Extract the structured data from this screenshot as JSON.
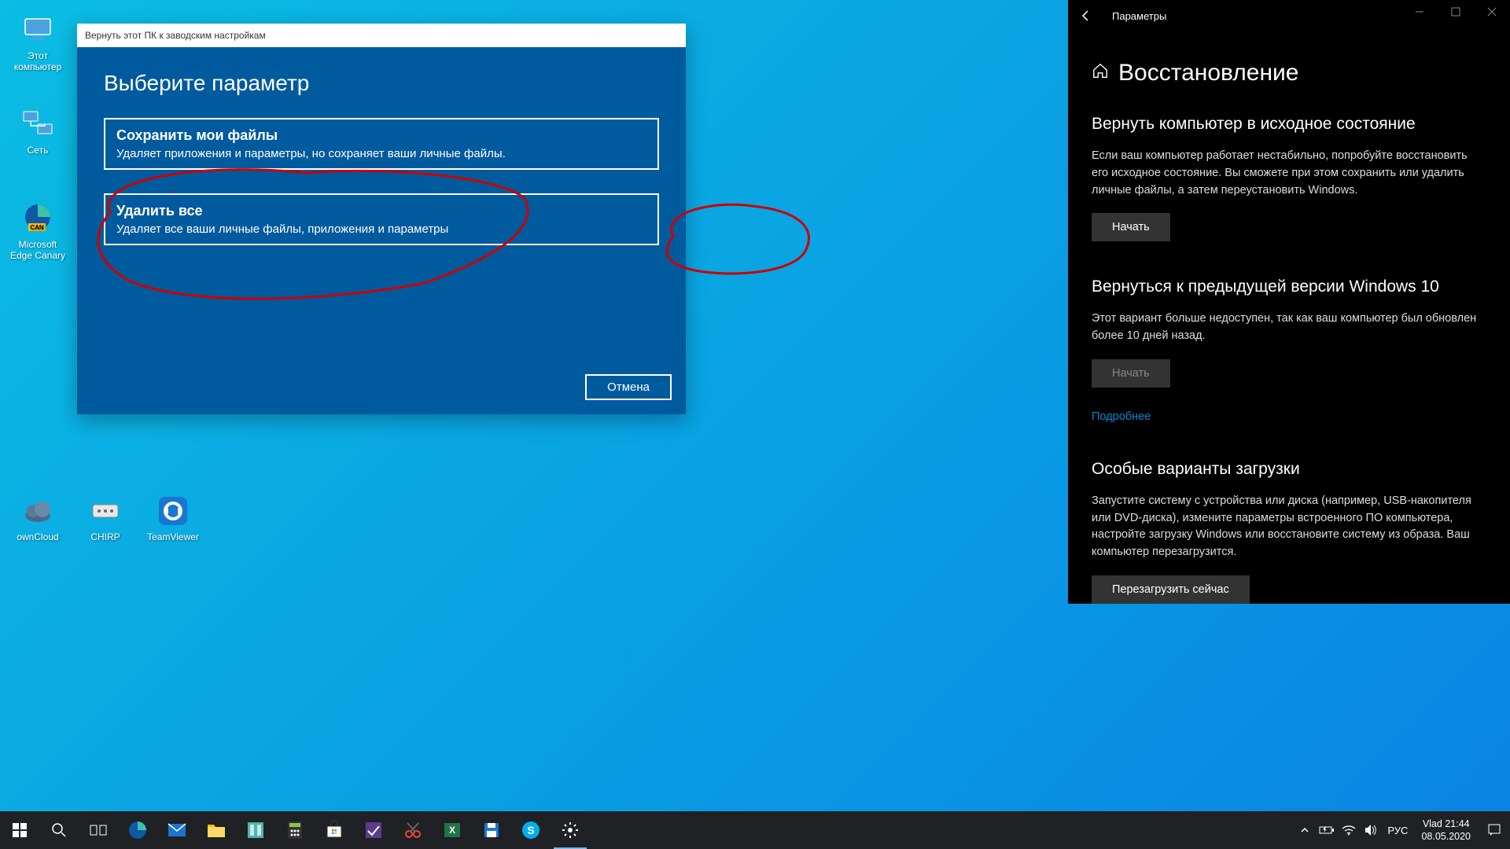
{
  "desktop": {
    "icons": [
      {
        "label": "Этот компьютер"
      },
      {
        "label": "Сеть"
      },
      {
        "label": "Microsoft Edge Canary"
      },
      {
        "label": "ownCloud"
      },
      {
        "label": "CHIRP"
      },
      {
        "label": "TeamViewer"
      }
    ]
  },
  "reset_dialog": {
    "title": "Вернуть этот ПК к заводским настройкам",
    "heading": "Выберите параметр",
    "option1_title": "Сохранить мои файлы",
    "option1_desc": "Удаляет приложения и параметры, но сохраняет ваши личные файлы.",
    "option2_title": "Удалить все",
    "option2_desc": "Удаляет все ваши личные файлы, приложения и параметры",
    "cancel": "Отмена"
  },
  "settings": {
    "window_title": "Параметры",
    "page_title": "Восстановление",
    "sec1_h": "Вернуть компьютер в исходное состояние",
    "sec1_p": "Если ваш компьютер работает нестабильно, попробуйте восстановить его исходное состояние. Вы сможете при этом сохранить или удалить личные файлы, а затем переустановить Windows.",
    "sec1_btn": "Начать",
    "sec2_h": "Вернуться к предыдущей версии Windows 10",
    "sec2_p": "Этот вариант больше недоступен, так как ваш компьютер был обновлен более 10 дней назад.",
    "sec2_btn": "Начать",
    "sec2_link": "Подробнее",
    "sec3_h": "Особые варианты загрузки",
    "sec3_p": "Запустите систему с устройства или диска (например, USB-накопителя или DVD-диска), измените параметры встроенного ПО компьютера, настройте загрузку Windows или восстановите систему из образа. Ваш компьютер перезагрузится.",
    "sec3_btn": "Перезагрузить сейчас"
  },
  "taskbar": {
    "lang": "РУС",
    "user": "Vlad",
    "time": "21:44",
    "date": "08.05.2020"
  }
}
